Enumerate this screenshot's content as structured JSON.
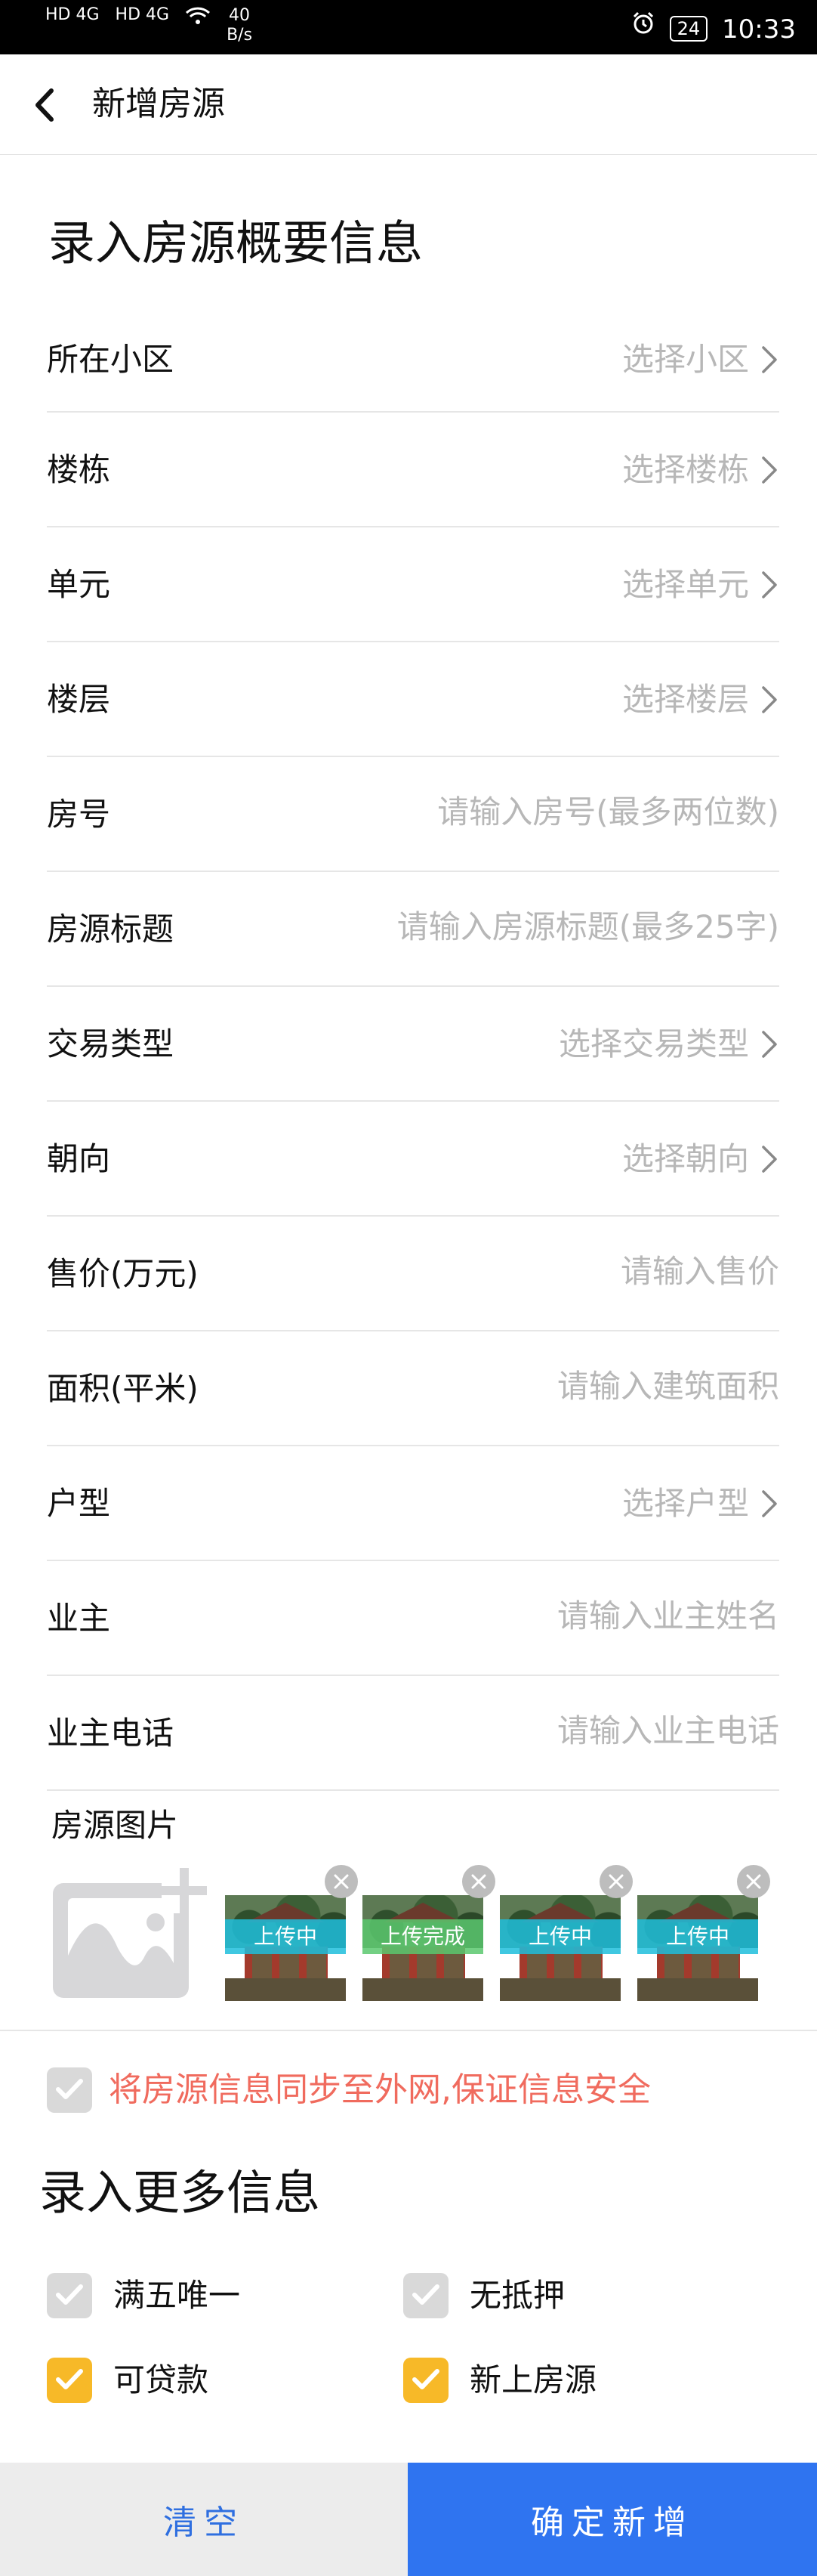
{
  "status_bar": {
    "network_1": "HD 4G",
    "network_2": "HD 4G",
    "speed_value": "40",
    "speed_unit": "B/s",
    "battery": "24",
    "time": "10:33"
  },
  "header": {
    "title": "新增房源"
  },
  "section_basic": {
    "title": "录入房源概要信息"
  },
  "form_rows": [
    {
      "label": "所在小区",
      "value": "选择小区",
      "kind": "select"
    },
    {
      "label": "楼栋",
      "value": "选择楼栋",
      "kind": "select"
    },
    {
      "label": "单元",
      "value": "选择单元",
      "kind": "select"
    },
    {
      "label": "楼层",
      "value": "选择楼层",
      "kind": "select"
    },
    {
      "label": "房号",
      "value": "请输入房号(最多两位数)",
      "kind": "input"
    },
    {
      "label": "房源标题",
      "value": "请输入房源标题(最多25字)",
      "kind": "input"
    },
    {
      "label": "交易类型",
      "value": "选择交易类型",
      "kind": "select"
    },
    {
      "label": "朝向",
      "value": "选择朝向",
      "kind": "select"
    },
    {
      "label": "售价(万元)",
      "value": "请输入售价",
      "kind": "input"
    },
    {
      "label": "面积(平米)",
      "value": "请输入建筑面积",
      "kind": "input"
    },
    {
      "label": "户型",
      "value": "选择户型",
      "kind": "select"
    },
    {
      "label": "业主",
      "value": "请输入业主姓名",
      "kind": "input"
    },
    {
      "label": "业主电话",
      "value": "请输入业主电话",
      "kind": "input"
    }
  ],
  "photos": {
    "label": "房源图片",
    "items": [
      {
        "status": "上传中"
      },
      {
        "status": "上传完成"
      },
      {
        "status": "上传中"
      },
      {
        "status": "上传中"
      }
    ]
  },
  "sync": {
    "text": "将房源信息同步至外网,保证信息安全",
    "checked": false
  },
  "section_more": {
    "title": "录入更多信息"
  },
  "more_options": [
    {
      "label": "满五唯一",
      "checked": false
    },
    {
      "label": "无抵押",
      "checked": false
    },
    {
      "label": "可贷款",
      "checked": true
    },
    {
      "label": "新上房源",
      "checked": true
    }
  ],
  "buttons": {
    "clear": "清空",
    "confirm": "确定新增"
  },
  "colors": {
    "accent": "#2f74f0",
    "check_on": "#f7b928",
    "check_off": "#d9d9d9",
    "warning_text": "#f06b5e",
    "uploading": "#1ebedc",
    "uploaded": "#5ac86e"
  }
}
